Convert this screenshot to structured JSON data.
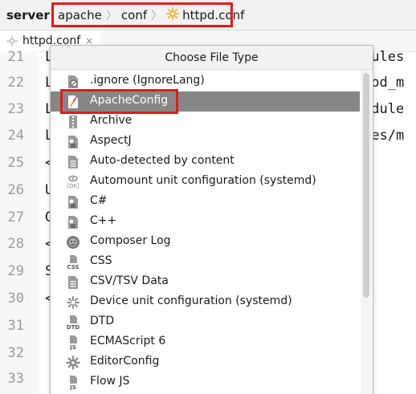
{
  "navbar": {
    "project": "server",
    "crumbs": [
      "apache",
      "conf",
      "httpd.conf"
    ]
  },
  "tabs": [
    {
      "label": "httpd.conf",
      "close": "×"
    }
  ],
  "editor": {
    "line_numbers": [
      "21",
      "22",
      "23",
      "24",
      "25",
      "26",
      "27",
      "28",
      "29",
      "30",
      "31",
      "32",
      "33"
    ],
    "line_starts": [
      "L",
      "L",
      "L",
      "L",
      "<",
      "U",
      "G",
      "<",
      "S",
      "<",
      "",
      "",
      ""
    ],
    "right_text": {
      "l21": "dules",
      "l22": "mod_m",
      "l23": "odule",
      "l24": "les/m"
    }
  },
  "popup": {
    "title": "Choose File Type",
    "items": [
      {
        "label": ".ignore (IgnoreLang)",
        "icon": "ignore-file-icon"
      },
      {
        "label": "ApacheConfig",
        "icon": "apache-feather-icon",
        "selected": true
      },
      {
        "label": "Archive",
        "icon": "archive-icon"
      },
      {
        "label": "AspectJ",
        "icon": "aspectj-file-icon"
      },
      {
        "label": "Auto-detected by content",
        "icon": "text-file-icon"
      },
      {
        "label": "Automount unit configuration (systemd)",
        "icon": "systemd-ok-icon"
      },
      {
        "label": "C#",
        "icon": "csharp-file-icon"
      },
      {
        "label": "C++",
        "icon": "cpp-file-icon"
      },
      {
        "label": "Composer Log",
        "icon": "composer-icon"
      },
      {
        "label": "CSS",
        "icon": "css-file-icon"
      },
      {
        "label": "CSV/TSV Data",
        "icon": "csv-file-icon"
      },
      {
        "label": "Device unit configuration (systemd)",
        "icon": "systemd-device-icon"
      },
      {
        "label": "DTD",
        "icon": "dtd-file-icon"
      },
      {
        "label": "ECMAScript 6",
        "icon": "js-file-icon"
      },
      {
        "label": "EditorConfig",
        "icon": "gear-icon"
      },
      {
        "label": "Flow JS",
        "icon": "js-flow-icon"
      }
    ]
  },
  "colors": {
    "highlight_red": "#e41b17",
    "selection_gray": "#868686"
  }
}
